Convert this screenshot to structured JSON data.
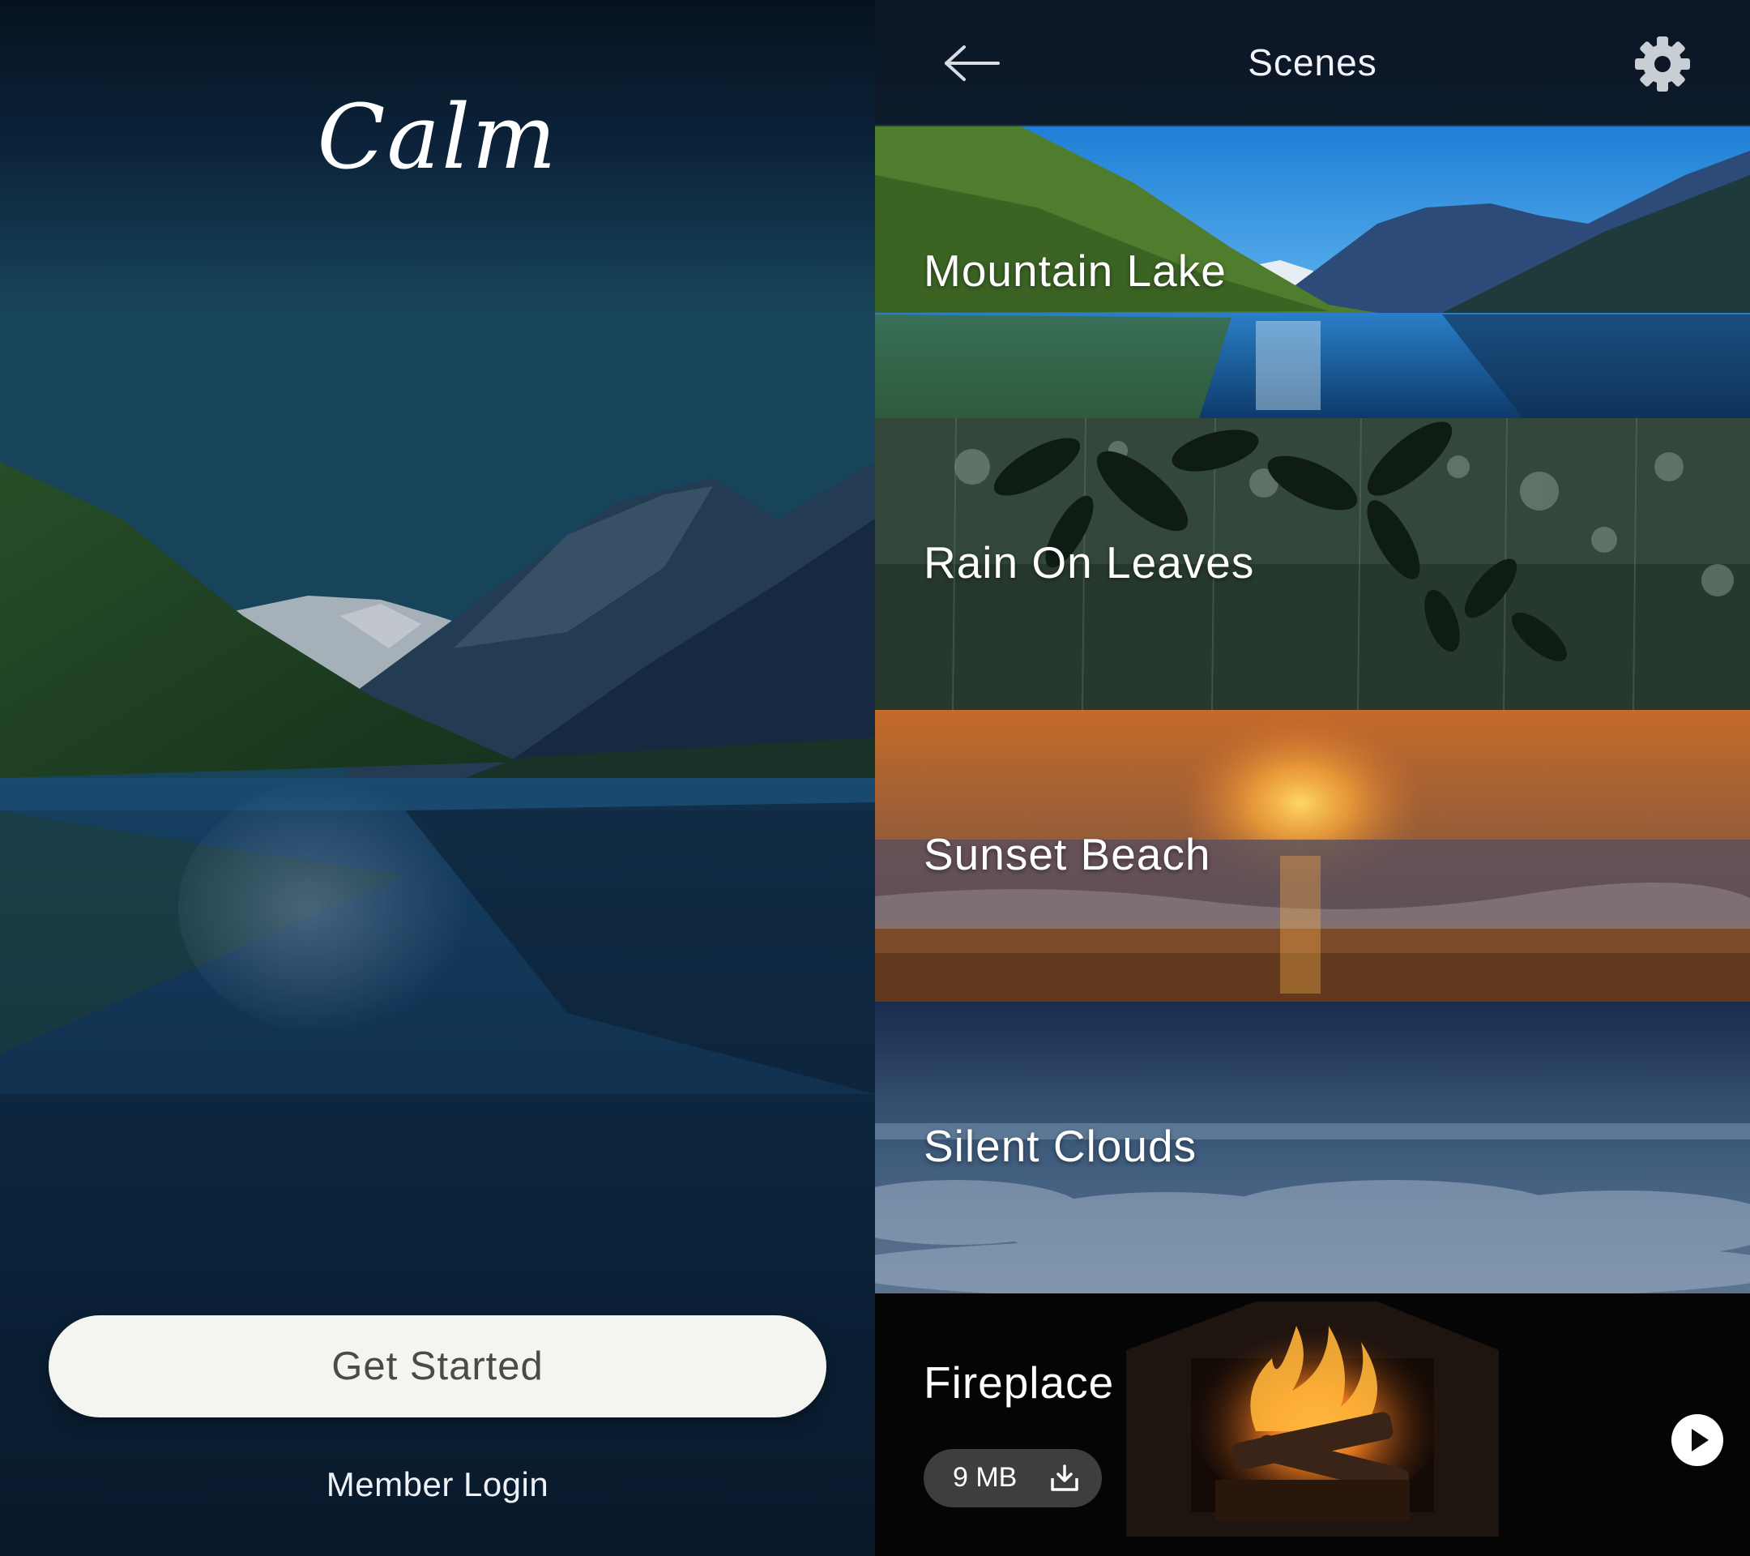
{
  "welcome": {
    "logo_text": "Calm",
    "get_started_label": "Get Started",
    "member_login_label": "Member Login"
  },
  "scenes_screen": {
    "title": "Scenes",
    "scenes": [
      {
        "label": "Mountain Lake"
      },
      {
        "label": "Rain On Leaves"
      },
      {
        "label": "Sunset Beach"
      },
      {
        "label": "Silent Clouds"
      },
      {
        "label": "Fireplace",
        "size": "9 MB"
      }
    ]
  },
  "icons": [
    "back-arrow-icon",
    "gear-icon",
    "download-icon",
    "play-icon"
  ],
  "colors": {
    "button_bg": "#f4f4f1",
    "button_text": "#4a4a4a",
    "header_bg": "#0c1624"
  }
}
